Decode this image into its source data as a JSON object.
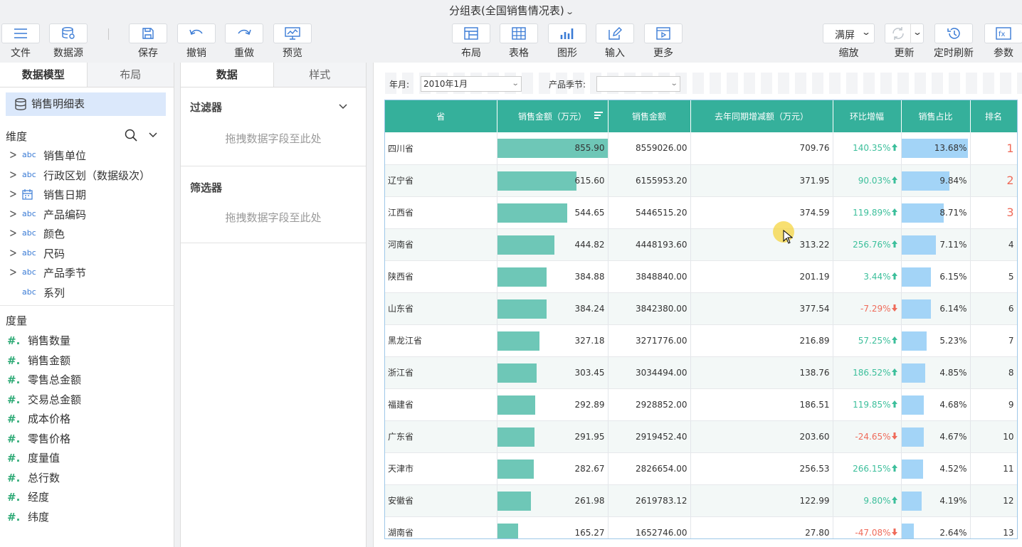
{
  "title": "分组表(全国销售情况表)",
  "toolbar": {
    "file": "文件",
    "datasource": "数据源",
    "save": "保存",
    "undo": "撤销",
    "redo": "重做",
    "preview": "预览",
    "layout": "布局",
    "table": "表格",
    "chart": "图形",
    "input": "输入",
    "more": "更多",
    "zoom_value": "满屏",
    "zoom": "缩放",
    "refresh": "更新",
    "timed_refresh": "定时刷新",
    "params": "参数"
  },
  "left": {
    "tabs": [
      "数据模型",
      "布局"
    ],
    "table_name": "销售明细表",
    "dim_title": "维度",
    "dimensions": [
      {
        "type": "abc",
        "name": "销售单位",
        "expand": true
      },
      {
        "type": "abc",
        "name": "行政区划（数据级次）",
        "expand": true
      },
      {
        "type": "date",
        "name": "销售日期",
        "expand": true
      },
      {
        "type": "abc",
        "name": "产品编码",
        "expand": true
      },
      {
        "type": "abc",
        "name": "颜色",
        "expand": true
      },
      {
        "type": "abc",
        "name": "尺码",
        "expand": true
      },
      {
        "type": "abc",
        "name": "产品季节",
        "expand": true
      },
      {
        "type": "abc",
        "name": "系列",
        "expand": false
      }
    ],
    "mea_title": "度量",
    "measures": [
      "销售数量",
      "销售金额",
      "零售总金额",
      "交易总金额",
      "成本价格",
      "零售价格",
      "度量值",
      "总行数",
      "经度",
      "纬度"
    ]
  },
  "mid": {
    "tabs": [
      "数据",
      "样式"
    ],
    "filter_title": "过滤器",
    "filter_drop": "拖拽数据字段至此处",
    "screen_title": "筛选器",
    "screen_drop": "拖拽数据字段至此处"
  },
  "filters": {
    "year_label": "年月:",
    "year_value": "2010年1月",
    "season_label": "产品季节:",
    "season_value": ""
  },
  "table": {
    "headers": [
      "省",
      "销售金额（万元）",
      "销售金额",
      "去年同期增减额（万元）",
      "环比增幅",
      "销售占比",
      "排名"
    ],
    "rows": [
      {
        "prov": "四川省",
        "amt_w": 855.9,
        "amt": "8559026.00",
        "yoy": "709.76",
        "mom": "140.35%",
        "dir": "up",
        "share": 13.68,
        "rank": "1"
      },
      {
        "prov": "辽宁省",
        "amt_w": 615.6,
        "amt": "6155953.20",
        "yoy": "371.95",
        "mom": "90.03%",
        "dir": "up",
        "share": 9.84,
        "rank": "2"
      },
      {
        "prov": "江西省",
        "amt_w": 544.65,
        "amt": "5446515.20",
        "yoy": "374.59",
        "mom": "119.89%",
        "dir": "up",
        "share": 8.71,
        "rank": "3"
      },
      {
        "prov": "河南省",
        "amt_w": 444.82,
        "amt": "4448193.60",
        "yoy": "313.22",
        "mom": "256.76%",
        "dir": "up",
        "share": 7.11,
        "rank": "4"
      },
      {
        "prov": "陕西省",
        "amt_w": 384.88,
        "amt": "3848840.00",
        "yoy": "201.19",
        "mom": "3.44%",
        "dir": "up",
        "share": 6.15,
        "rank": "5"
      },
      {
        "prov": "山东省",
        "amt_w": 384.24,
        "amt": "3842380.00",
        "yoy": "377.54",
        "mom": "-7.29%",
        "dir": "down",
        "share": 6.14,
        "rank": "6"
      },
      {
        "prov": "黑龙江省",
        "amt_w": 327.18,
        "amt": "3271776.00",
        "yoy": "216.89",
        "mom": "57.25%",
        "dir": "up",
        "share": 5.23,
        "rank": "7"
      },
      {
        "prov": "浙江省",
        "amt_w": 303.45,
        "amt": "3034494.00",
        "yoy": "138.76",
        "mom": "186.52%",
        "dir": "up",
        "share": 4.85,
        "rank": "8"
      },
      {
        "prov": "福建省",
        "amt_w": 292.89,
        "amt": "2928852.00",
        "yoy": "186.51",
        "mom": "119.85%",
        "dir": "up",
        "share": 4.68,
        "rank": "9"
      },
      {
        "prov": "广东省",
        "amt_w": 291.95,
        "amt": "2919452.40",
        "yoy": "203.60",
        "mom": "-24.65%",
        "dir": "down",
        "share": 4.67,
        "rank": "10"
      },
      {
        "prov": "天津市",
        "amt_w": 282.67,
        "amt": "2826654.00",
        "yoy": "256.53",
        "mom": "266.15%",
        "dir": "up",
        "share": 4.52,
        "rank": "11"
      },
      {
        "prov": "安徽省",
        "amt_w": 261.98,
        "amt": "2619783.12",
        "yoy": "122.99",
        "mom": "9.80%",
        "dir": "up",
        "share": 4.19,
        "rank": "12"
      },
      {
        "prov": "湖南省",
        "amt_w": 165.27,
        "amt": "1652746.00",
        "yoy": "27.80",
        "mom": "-47.08%",
        "dir": "down",
        "share": 2.64,
        "rank": "13"
      }
    ]
  },
  "colors": {
    "header": "#35b09b",
    "bar": "#6ec7b7",
    "share_bar": "#a3d4f7",
    "up": "#3cbf9b",
    "down": "#ef6b5a"
  }
}
